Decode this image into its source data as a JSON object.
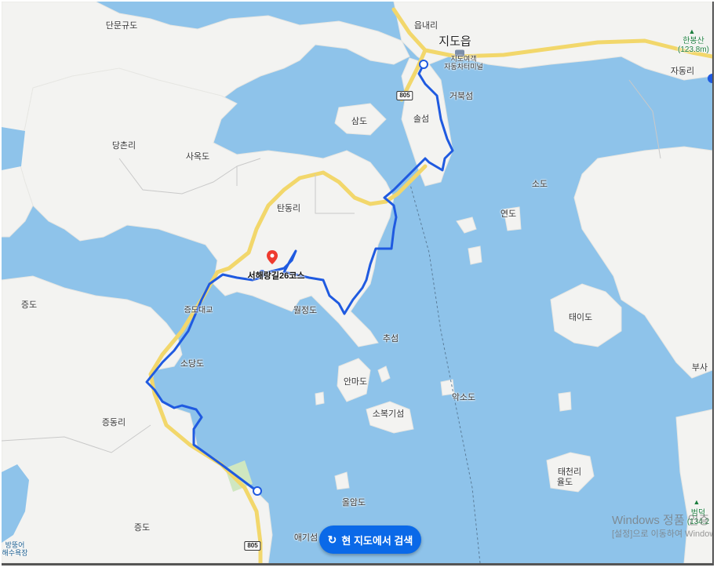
{
  "map": {
    "region_labels": [
      {
        "id": "dan-mun-gyu-do",
        "text": "단문규도",
        "kind": "island"
      },
      {
        "id": "eup-nae-ri",
        "text": "읍내리",
        "kind": "village"
      },
      {
        "id": "jido-eup",
        "text": "지도읍",
        "kind": "town"
      },
      {
        "id": "terminal",
        "text": "지도여객\n자동차터미널",
        "kind": "poi"
      },
      {
        "id": "hanbongsan",
        "text": "한봉산\n(123.8m)",
        "kind": "mountain"
      },
      {
        "id": "ja-dong-ri",
        "text": "자동리",
        "kind": "village"
      },
      {
        "id": "geobuk-seom",
        "text": "거북섬",
        "kind": "island"
      },
      {
        "id": "sol-seom",
        "text": "솔섬",
        "kind": "island"
      },
      {
        "id": "sam-do",
        "text": "삼도",
        "kind": "island"
      },
      {
        "id": "dang-chon-ri",
        "text": "당촌리",
        "kind": "village"
      },
      {
        "id": "sa-ok-do",
        "text": "사옥도",
        "kind": "island"
      },
      {
        "id": "tan-dong-ri",
        "text": "탄동리",
        "kind": "village"
      },
      {
        "id": "so-do",
        "text": "소도",
        "kind": "island"
      },
      {
        "id": "yeon-do",
        "text": "연도",
        "kind": "island"
      },
      {
        "id": "jeung-do-w",
        "text": "증도",
        "kind": "island"
      },
      {
        "id": "jeungdo-bridge",
        "text": "증도대교",
        "kind": "bridge"
      },
      {
        "id": "wol-jeong-do",
        "text": "월정도",
        "kind": "island"
      },
      {
        "id": "chu-seom",
        "text": "추섬",
        "kind": "island"
      },
      {
        "id": "tai-do",
        "text": "태이도",
        "kind": "island"
      },
      {
        "id": "so-dang-do",
        "text": "소당도",
        "kind": "island"
      },
      {
        "id": "an-ma-do",
        "text": "안마도",
        "kind": "island"
      },
      {
        "id": "ak-so-do",
        "text": "악소도",
        "kind": "island"
      },
      {
        "id": "so-bok-gi-seom",
        "text": "소복기섬",
        "kind": "island"
      },
      {
        "id": "jeung-dong-ri",
        "text": "증동리",
        "kind": "village"
      },
      {
        "id": "bu-sa",
        "text": "부사",
        "kind": "island"
      },
      {
        "id": "tae-cheon-ri",
        "text": "태천리",
        "kind": "village"
      },
      {
        "id": "yul-do",
        "text": "율도",
        "kind": "island"
      },
      {
        "id": "ol-am-do",
        "text": "올암도",
        "kind": "island"
      },
      {
        "id": "jeung-do-s",
        "text": "증도",
        "kind": "island"
      },
      {
        "id": "ae-gi-seom",
        "text": "애기섬",
        "kind": "island"
      },
      {
        "id": "beomdeok",
        "text": "범덕\n(134.2",
        "kind": "mountain"
      },
      {
        "id": "bangdeung",
        "text": "방뚱어\n해수욕장",
        "kind": "beach"
      }
    ],
    "route_shields": [
      "805",
      "805"
    ],
    "route_name": "서해랑길26코스",
    "colors": {
      "water": "#8ec3ea",
      "land": "#f4f4f2",
      "route": "#1f5ae0",
      "road": "#f2d76b",
      "pin": "#ee3b2f"
    }
  },
  "controls": {
    "search_here_label": "현 지도에서 검색",
    "search_here_icon": "refresh-icon"
  },
  "watermark": {
    "line1": "Windows 정품 인증",
    "line2": "[설정]으로 이동하여 Windows를 정품 인증합니다."
  }
}
